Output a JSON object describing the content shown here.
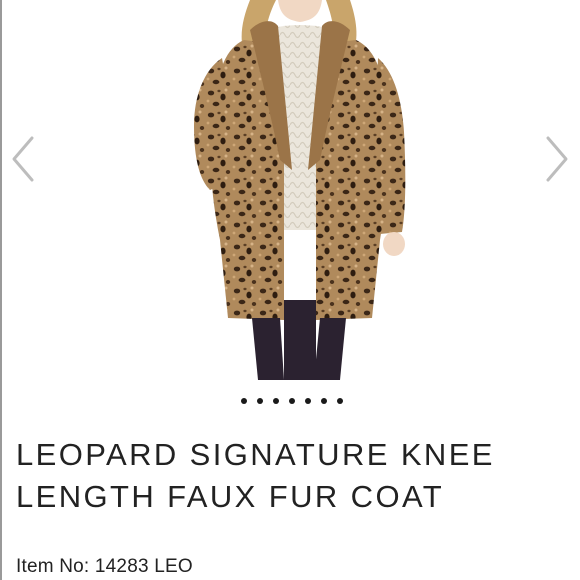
{
  "carousel": {
    "image_alt": "Woman wearing leopard print faux fur coat",
    "prev_icon": "chevron-left-icon",
    "next_icon": "chevron-right-icon",
    "slide_count": 7,
    "active_slide": 1
  },
  "product": {
    "title_line1": "LEOPARD SIGNATURE KNEE",
    "title_line2": "LENGTH FAUX FUR COAT",
    "item_no_label": "Item No:",
    "item_no_value": "14283 LEO"
  },
  "colors": {
    "text": "#222222",
    "arrow": "#bdbdbd",
    "dot": "#1a1a1a"
  }
}
